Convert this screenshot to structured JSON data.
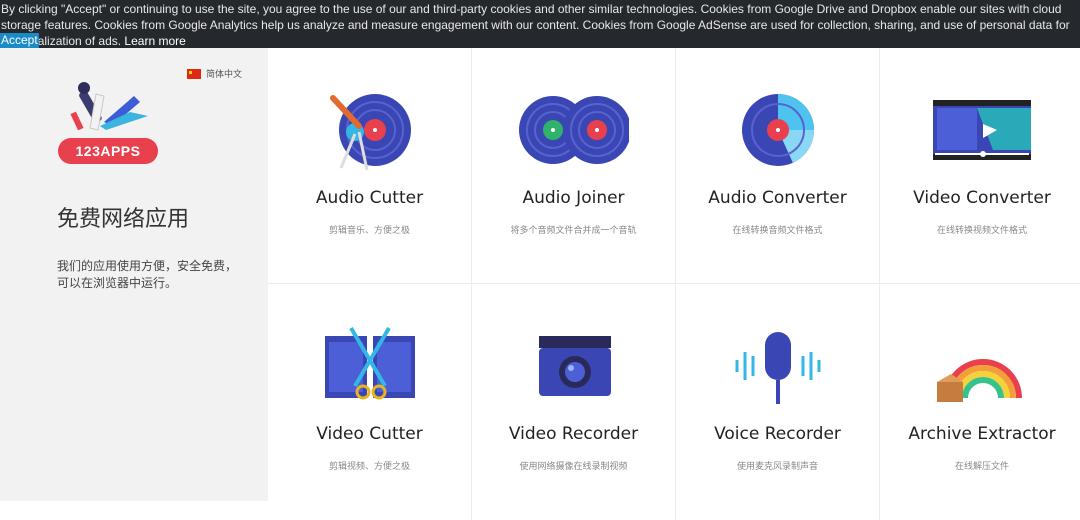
{
  "cookie_banner": {
    "text": "By clicking \"Accept\" or continuing to use the site, you agree to the use of our and third-party cookies and other similar technologies. Cookies from Google Drive and Dropbox enable our sites with cloud storage features. Cookies from Google Analytics help us analyze and measure engagement with our content. Cookies from Google AdSense are used for collection, sharing, and use of personal data for personalization of ads.",
    "learn_more": "Learn more",
    "accept": "Accept"
  },
  "sidebar": {
    "language": "简体中文",
    "logo_text": "123APPS",
    "title": "免费网络应用",
    "description_line1": "我们的应用使用方便，安全免费，",
    "description_line2": "可以在浏览器中运行。"
  },
  "apps": [
    {
      "name": "Audio Cutter",
      "desc": "剪辑音乐、方便之极",
      "icon": "audio-cutter-icon"
    },
    {
      "name": "Audio Joiner",
      "desc": "将多个音频文件合并成一个音轨",
      "icon": "audio-joiner-icon"
    },
    {
      "name": "Audio Converter",
      "desc": "在线转换音频文件格式",
      "icon": "audio-converter-icon"
    },
    {
      "name": "Video Converter",
      "desc": "在线转换视频文件格式",
      "icon": "video-converter-icon"
    },
    {
      "name": "Video Cutter",
      "desc": "剪辑视频、方便之极",
      "icon": "video-cutter-icon"
    },
    {
      "name": "Video Recorder",
      "desc": "使用网络摄像在线录制视频",
      "icon": "video-recorder-icon"
    },
    {
      "name": "Voice Recorder",
      "desc": "使用麦克风录制声音",
      "icon": "voice-recorder-icon"
    },
    {
      "name": "Archive Extractor",
      "desc": "在线解压文件",
      "icon": "archive-extractor-icon"
    }
  ]
}
